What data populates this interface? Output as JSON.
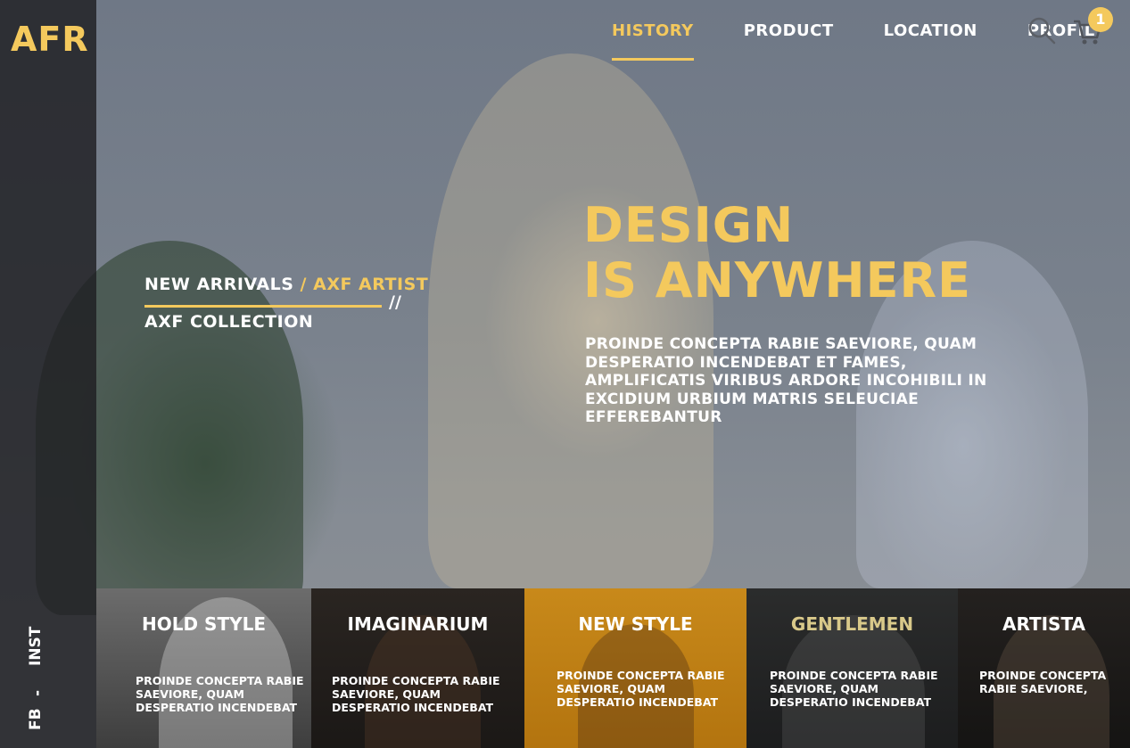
{
  "brand": {
    "logo": "AFR"
  },
  "nav": {
    "items": [
      "HISTORY",
      "PRODUCT",
      "LOCATION",
      "PROFIL"
    ],
    "active_index": 0
  },
  "icons": {
    "search": "search-icon",
    "cart": "cart-icon"
  },
  "cart": {
    "count": "1"
  },
  "breadcrumb": {
    "part1": "NEW ARRIVALS",
    "separator": "/",
    "part2": "AXF ARTIST",
    "slashes": "//",
    "line2": "AXF COLLECTION"
  },
  "hero": {
    "title_line1": "DESIGN",
    "title_line2": "IS ANYWHERE",
    "text": "PROINDE CONCEPTA RABIE SAEVIORE, QUAM DESPERATIO INCENDEBAT ET FAMES, AMPLIFICATIS VIRIBUS ARDORE INCOHIBILI IN EXCIDIUM URBIUM MATRIS SELEUCIAE EFFEREBANTUR"
  },
  "social": {
    "fb": "FB",
    "dash": "-",
    "inst": "INST"
  },
  "cards": [
    {
      "title": "HOLD STYLE",
      "desc": "PROINDE CONCEPTA RABIE SAEVIORE, QUAM DESPERATIO INCENDEBAT"
    },
    {
      "title": "IMAGINARIUM",
      "desc": "PROINDE CONCEPTA RABIE SAEVIORE, QUAM DESPERATIO INCENDEBAT"
    },
    {
      "title": "NEW STYLE",
      "desc": "PROINDE CONCEPTA RABIE SAEVIORE, QUAM DESPERATIO INCENDEBAT"
    },
    {
      "title": "GENTLEMEN",
      "desc": "PROINDE CONCEPTA RABIE SAEVIORE, QUAM DESPERATIO INCENDEBAT"
    },
    {
      "title": "ARTISTA",
      "desc": "PROINDE CONCEPTA RABIE SAEVIORE,"
    }
  ],
  "colors": {
    "accent": "#f4c95d",
    "sidebar": "#1e1f22",
    "text": "#ffffff"
  }
}
